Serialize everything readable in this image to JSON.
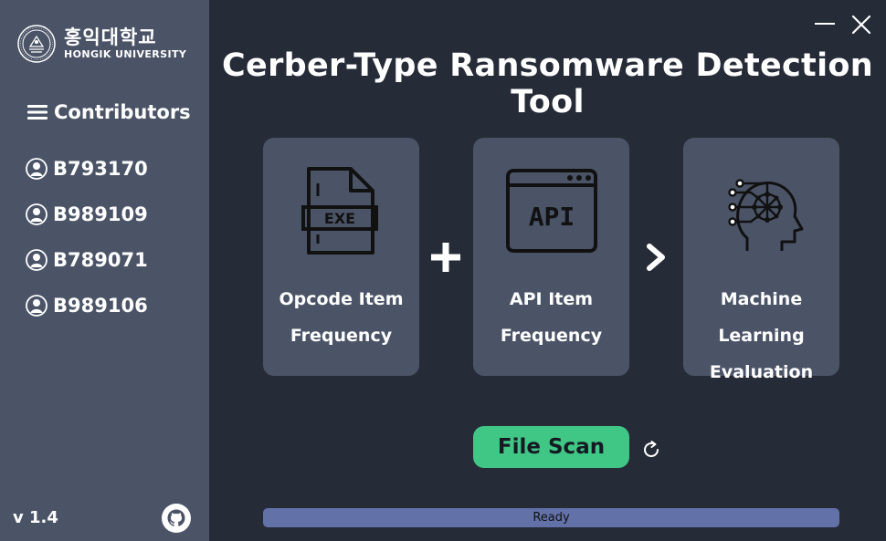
{
  "app": {
    "title": "Cerber-Type Ransomware Detection Tool",
    "version": "v 1.4"
  },
  "logo": {
    "korean": "홍익대학교",
    "english": "HONGIK UNIVERSITY"
  },
  "sidebar": {
    "header": "Contributors",
    "contributors": [
      "B793170",
      "B989109",
      "B789071",
      "B989106"
    ]
  },
  "cards": [
    {
      "icon": "exe-file-icon",
      "line1": "Opcode Item",
      "line2": "Frequency"
    },
    {
      "icon": "api-window-icon",
      "line1": "API Item",
      "line2": "Frequency"
    },
    {
      "icon": "ai-brain-icon",
      "line1": "Machine Learning",
      "line2": "Evaluation"
    }
  ],
  "actions": {
    "scan_label": "File Scan"
  },
  "status": {
    "text": "Ready",
    "progress": 0
  },
  "colors": {
    "background": "#262b38",
    "sidebar": "#4b5467",
    "card": "#4b5467",
    "accent": "#40c786",
    "progress_bar": "#6271a8"
  }
}
